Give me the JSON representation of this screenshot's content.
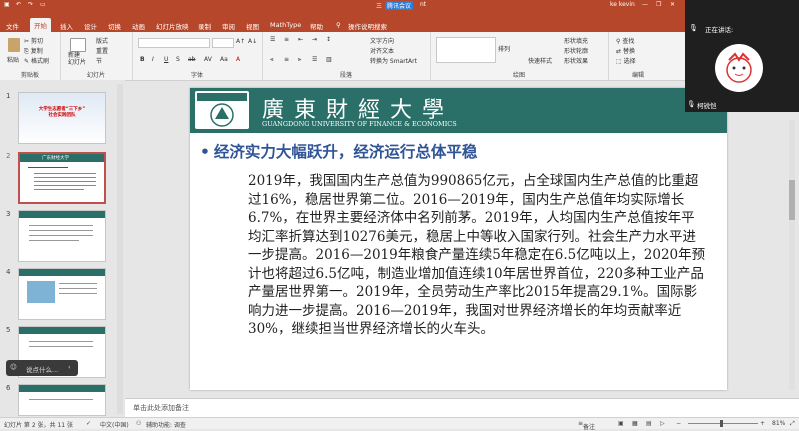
{
  "window": {
    "title": "三",
    "meeting_tag": "腾讯会议",
    "title_suffix": "nt",
    "user": "ke kevin",
    "controls": [
      "minimize",
      "restore",
      "close"
    ]
  },
  "tabs": [
    "文件",
    "开始",
    "插入",
    "设计",
    "切换",
    "动画",
    "幻灯片放映",
    "录制",
    "审阅",
    "视图",
    "MathType",
    "帮助",
    "操作说明搜索"
  ],
  "active_tab": "开始",
  "ribbon": {
    "clipboard": {
      "label": "剪贴板",
      "paste": "粘贴",
      "cut": "剪切",
      "copy": "复制",
      "format_painter": "格式刷"
    },
    "slides": {
      "label": "幻灯片",
      "new_slide": "新建\n幻灯片",
      "layout": "版式",
      "reset": "重置",
      "section": "节"
    },
    "font": {
      "label": "字体"
    },
    "paragraph": {
      "label": "段落",
      "text_direction": "文字方向",
      "align_text": "对齐文本",
      "smartart": "转换为 SmartArt"
    },
    "drawing": {
      "label": "绘图",
      "arrange": "排列",
      "quick_styles": "快速样式",
      "shape_fill": "形状填充",
      "shape_outline": "形状轮廓",
      "shape_effects": "形状效果"
    },
    "editing": {
      "label": "编辑",
      "find": "查找",
      "replace": "替换",
      "select": "选择"
    }
  },
  "thumbnails": [
    {
      "num": "1",
      "title": "大学生志愿者“三下乡”\n社会实践团队"
    },
    {
      "num": "2",
      "title": "广东财经大学"
    },
    {
      "num": "3",
      "title": ""
    },
    {
      "num": "4",
      "title": ""
    },
    {
      "num": "5",
      "title": ""
    },
    {
      "num": "6",
      "title": ""
    }
  ],
  "slide": {
    "school_cn": "廣東財經大學",
    "school_en": "GUANGDONG UNIVERSITY OF FINANCE & ECONOMICS",
    "heading": "经济实力大幅跃升，经济运行总体平稳",
    "body": "2019年，我国国内生产总值为990865亿元，占全球国内生产总值的比重超过16%，稳居世界第二位。2016—2019年，国内生产总值年均实际增长6.7%，在世界主要经济体中名列前茅。2019年，人均国内生产总值按年平均汇率折算达到10276美元，稳居上中等收入国家行列。社会生产力水平进一步提高。2016—2019年粮食产量连续5年稳定在6.5亿吨以上，2020年预计也将超过6.5亿吨，制造业增加值连续10年居世界首位，220多种工业产品产量居世界第一。2019年，全员劳动生产率比2015年提高29.1%。国际影响力进一步提高。2016—2019年，我国对世界经济增长的年均贡献率近30%，继续担当世界经济增长的火车头。"
  },
  "notes": {
    "placeholder": "单击此处添加备注"
  },
  "status": {
    "slide_info": "幻灯片 第 2 张，共 11 张",
    "language": "中文(中国)",
    "accessibility": "辅助功能: 调查",
    "notes_btn": "备注",
    "zoom": "81%"
  },
  "meeting": {
    "speaking_label": "正在讲话:",
    "participant": "柯锐恺"
  },
  "chat": {
    "text": "说点什么..."
  }
}
